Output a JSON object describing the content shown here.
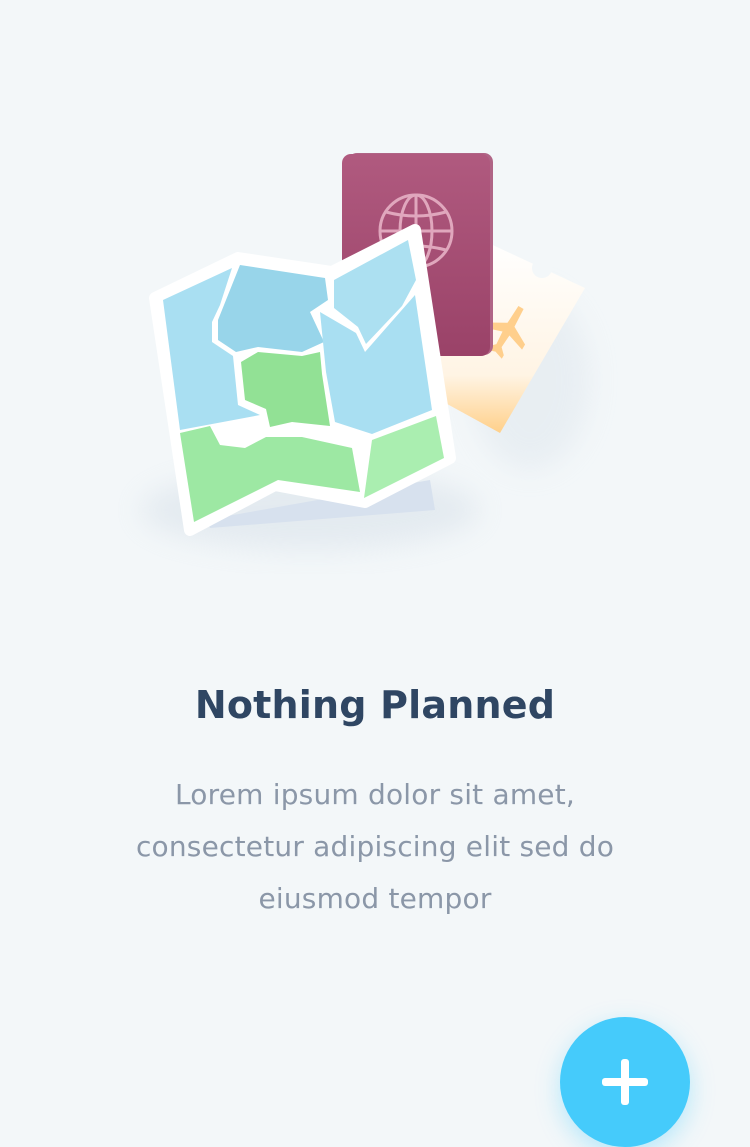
{
  "empty_state": {
    "illustration": {
      "icons": [
        "map-icon",
        "passport-icon",
        "ticket-icon",
        "globe-icon",
        "airplane-icon"
      ]
    },
    "title": "Nothing Planned",
    "description": "Lorem ipsum dolor sit amet, consectetur adipiscing elit sed do eiusmod tempor"
  },
  "fab": {
    "icon": "plus-icon",
    "color": "#45cbfb"
  },
  "colors": {
    "background": "#f3f7f9",
    "title": "#2f4663",
    "description": "#8b97a8",
    "passport": "#a14b72",
    "map_blue": "#a9dff2",
    "map_green": "#9de8a3"
  }
}
